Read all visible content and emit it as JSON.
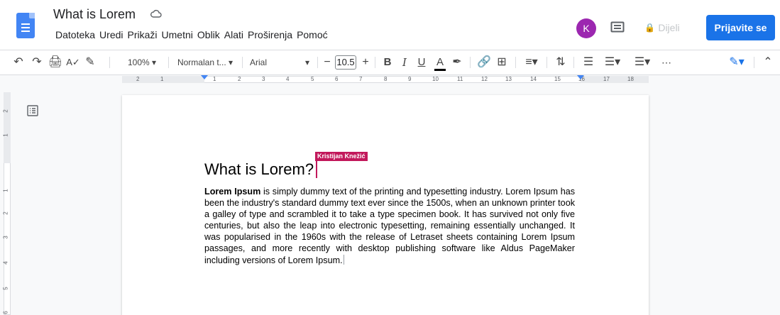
{
  "header": {
    "title": "What is Lorem",
    "menu": [
      "Datoteka",
      "Uredi",
      "Prikaži",
      "Umetni",
      "Oblik",
      "Alati",
      "Proširenja",
      "Pomoć"
    ],
    "avatar_initial": "K",
    "share_label": "Dijeli",
    "signin_label": "Prijavite se",
    "accent_color": "#1a73e8"
  },
  "toolbar": {
    "zoom": "100%",
    "style": "Normalan t...",
    "font": "Arial",
    "font_size": "10.5",
    "more": "⋯"
  },
  "ruler": {
    "numbers": [
      "2",
      "1",
      "1",
      "2",
      "3",
      "4",
      "5",
      "6",
      "7",
      "8",
      "9",
      "10",
      "11",
      "12",
      "13",
      "14",
      "15",
      "16",
      "17",
      "18"
    ]
  },
  "vruler": {
    "numbers": [
      "2",
      "1",
      "1",
      "2",
      "3",
      "4",
      "5",
      "6"
    ]
  },
  "document": {
    "collaborator": "Kristijan Knežić",
    "heading": "What is Lorem?",
    "para_bold": "Lorem Ipsum",
    "para_rest": " is simply dummy text of the printing and typesetting industry. Lorem Ipsum has been the industry's standard dummy text ever since the 1500s, when an unknown printer took a galley of type and scrambled it to take a type specimen book.  It has survived not only five centuries, but also the leap into electronic typesetting, remaining essentially unchanged. It was popularised in the 1960s with the release of Letraset sheets containing Lorem Ipsum passages, and more recently with desktop publishing software like Aldus PageMaker including versions of Lorem Ipsum."
  }
}
